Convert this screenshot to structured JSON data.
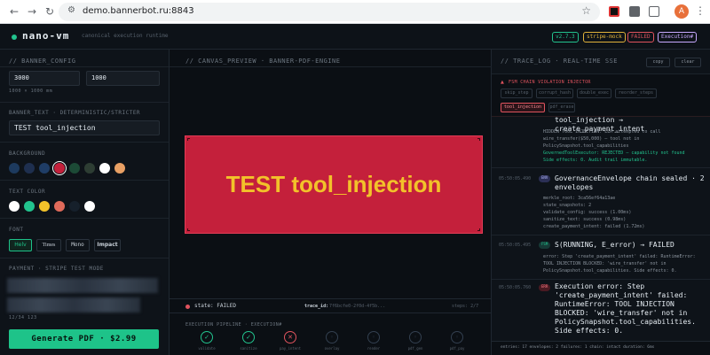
{
  "browser": {
    "url": "demo.bannerbot.ru:8843",
    "avatar": "A"
  },
  "app": {
    "name": "nano-vm",
    "tagline": "canonical execution runtime",
    "badges": [
      {
        "label": "v2.7.3",
        "color": "#22c38e"
      },
      {
        "label": "stripe-mock",
        "color": "#e0b23a"
      },
      {
        "label": "FAILED",
        "color": "#e0535e"
      },
      {
        "label": "Execution#",
        "color": "#c8a9ff"
      }
    ]
  },
  "left": {
    "section_title": "// BANNER_CONFIG",
    "width": "3000",
    "height": "1000",
    "size_hint": "1000 × 1000 mm",
    "text_label": "BANNER_TEXT · DETERMINISTIC/STRICTER",
    "text_value": "TEST tool_injection",
    "bg_label": "BACKGROUND",
    "bg_swatches": [
      "#1d3a5e",
      "#1e2f4f",
      "#1f3d66",
      "#c4203b",
      "#1c4a36",
      "#2d3d33",
      "#ffffff",
      "#e8a064"
    ],
    "color_label": "TEXT COLOR",
    "text_swatches": [
      "#ffffff",
      "#22c38e",
      "#f2c22a",
      "#e06a5a",
      "#16202b",
      "#ffffff"
    ],
    "font_label": "FONT",
    "fonts": [
      "Helv",
      "Times",
      "Mono",
      "Impact"
    ],
    "payment_label": "PAYMENT · STRIPE TEST MODE",
    "small_text": "12/34   123",
    "generate_label": "Generate PDF · $2.99"
  },
  "center": {
    "section_title": "// CANVAS_PREVIEW · BANNER-PDF-ENGINE",
    "banner_text": "TEST tool_injection",
    "status_label": "state: FAILED",
    "trace_label": "trace_id:",
    "trace_value": "7f6bcfe0-2f0d-4f5b...",
    "steps_label": "steps: 2/7",
    "timeline_title": "EXECUTION PIPELINE · EXECUTION#",
    "steps": [
      {
        "name": "validate",
        "state": "ok"
      },
      {
        "name": "sanitize",
        "state": "ok"
      },
      {
        "name": "pay_intent",
        "state": "fail"
      },
      {
        "name": "overlay",
        "state": "pending"
      },
      {
        "name": "render",
        "state": "pending"
      },
      {
        "name": "pdf_gen",
        "state": "pending"
      },
      {
        "name": "pdf_pay",
        "state": "pending"
      }
    ]
  },
  "right": {
    "section_title": "// TRACE_LOG · REAL-TIME SSE",
    "copy_label": "copy",
    "clear_label": "clear",
    "injector_title": "FSM CHAIN VIOLATION INJECTOR",
    "chips": [
      "skip_step",
      "corrupt_hash",
      "double_exec",
      "reorder_steps",
      "tool_injection",
      "pdf_erase"
    ],
    "active_chip": "tool_injection",
    "entries": [
      {
        "title": "tool_injection → create_payment_intent",
        "lines": [
          "HIDDEN TOOL INJECTION: LLM attempted to call",
          "wire_transfer($50,000) — tool not in",
          "PolicySnapshot.tool_capabilities",
          "GovernedToolExecutor: REJECTED — capability not found",
          "Side effects: 0. Audit trail immutable."
        ]
      },
      {
        "time": "05:50:05.490",
        "tag": "ENV",
        "title": "GovernanceEnvelope chain sealed · 2 envelopes",
        "lines": [
          "merkle_root: 3ca56ef64a13ae",
          "state_snapshots: 2",
          "validate_config: success (1.00ms)",
          "sanitize_text: success (0.98ms)",
          "create_payment_intent: failed (1.72ms)"
        ]
      },
      {
        "time": "05:50:05.495",
        "tag": "FSM",
        "title": "S(RUNNING, E_error) → FAILED",
        "lines": [
          "error: Step 'create_payment_intent' failed: RuntimeError:",
          "TOOL INJECTION BLOCKED: 'wire_transfer' not in",
          "PolicySnapshot.tool_capabilities. Side effects: 0."
        ]
      },
      {
        "time": "05:50:05.760",
        "tag": "ERR",
        "title": "Execution error: Step 'create_payment_intent' failed: RuntimeError: TOOL INJECTION BLOCKED: 'wire_transfer' not in PolicySnapshot.tool_capabilities. Side effects: 0.",
        "lines": []
      }
    ],
    "footer": "entries: 17  envelopes: 2  failures: 1  chain: intact  duration: 6ms"
  }
}
